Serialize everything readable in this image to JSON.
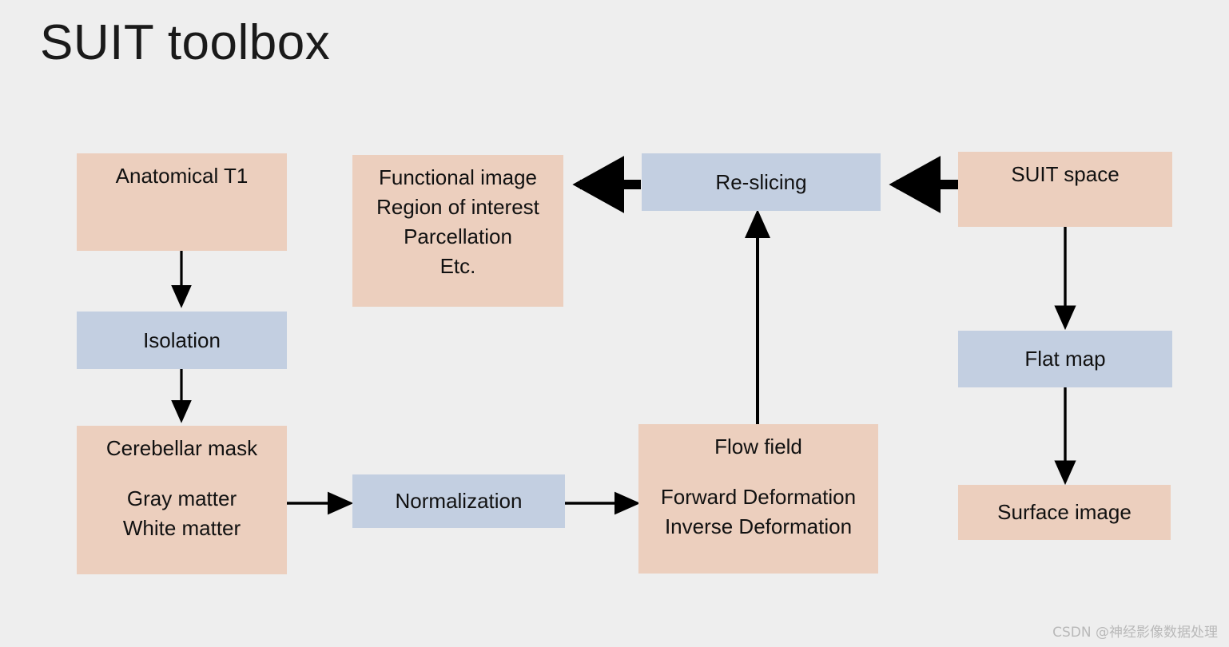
{
  "page": {
    "title": "SUIT toolbox",
    "background_color": "#eeeeee",
    "watermark": "CSDN @神经影像数据处理"
  },
  "colors": {
    "peach": "#eccfbe",
    "blue": "#c3cfe1",
    "arrow": "#000000",
    "text": "#111111"
  },
  "nodes": {
    "anatomical_t1": {
      "label": "Anatomical T1",
      "color": "peach"
    },
    "isolation": {
      "label": "Isolation",
      "color": "blue"
    },
    "cerebellar_mask": {
      "line1": "Cerebellar mask",
      "line2": "Gray matter",
      "line3": "White matter",
      "color": "peach"
    },
    "functional_image": {
      "line1": "Functional image",
      "line2": "Region of interest",
      "line3": "Parcellation",
      "line4": "Etc.",
      "color": "peach"
    },
    "normalization": {
      "label": "Normalization",
      "color": "blue"
    },
    "re_slicing": {
      "label": "Re-slicing",
      "color": "blue"
    },
    "flow_field": {
      "line1": "Flow field",
      "line2": "Forward Deformation",
      "line3": "Inverse Deformation",
      "color": "peach"
    },
    "suit_space": {
      "label": "SUIT space",
      "color": "peach"
    },
    "flat_map": {
      "label": "Flat map",
      "color": "blue"
    },
    "surface_image": {
      "label": "Surface image",
      "color": "peach"
    }
  },
  "edges": [
    {
      "name": "anatomical-t1-to-isolation",
      "from": "anatomical_t1",
      "to": "isolation",
      "style": "thin",
      "direction": "down"
    },
    {
      "name": "isolation-to-cerebellar-mask",
      "from": "isolation",
      "to": "cerebellar_mask",
      "style": "thin",
      "direction": "down"
    },
    {
      "name": "cerebellar-mask-to-normalization",
      "from": "cerebellar_mask",
      "to": "normalization",
      "style": "thin",
      "direction": "right"
    },
    {
      "name": "normalization-to-flow-field",
      "from": "normalization",
      "to": "flow_field",
      "style": "thin",
      "direction": "right"
    },
    {
      "name": "flow-field-to-re-slicing",
      "from": "flow_field",
      "to": "re_slicing",
      "style": "thin",
      "direction": "up"
    },
    {
      "name": "re-slicing-to-functional-image",
      "from": "re_slicing",
      "to": "functional_image",
      "style": "thick",
      "direction": "left"
    },
    {
      "name": "suit-space-to-re-slicing",
      "from": "suit_space",
      "to": "re_slicing",
      "style": "thick",
      "direction": "left"
    },
    {
      "name": "suit-space-to-flat-map",
      "from": "suit_space",
      "to": "flat_map",
      "style": "thin",
      "direction": "down"
    },
    {
      "name": "flat-map-to-surface-image",
      "from": "flat_map",
      "to": "surface_image",
      "style": "thin",
      "direction": "down"
    }
  ]
}
